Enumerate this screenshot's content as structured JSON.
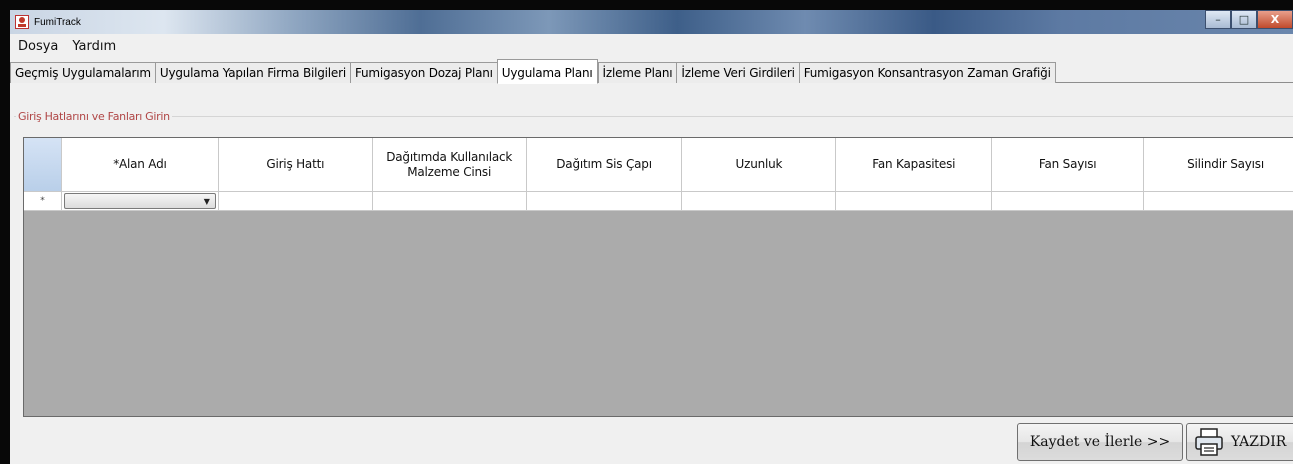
{
  "window": {
    "title": "FumiTrack",
    "controls": {
      "minimize": "–",
      "maximize": "□",
      "close": "X"
    }
  },
  "menu": {
    "items": [
      "Dosya",
      "Yardım"
    ]
  },
  "tabs": [
    "Geçmiş Uygulamalarım",
    "Uygulama Yapılan Firma Bilgileri",
    "Fumigasyon Dozaj Planı",
    "Uygulama Planı",
    "İzleme Planı",
    "İzleme Veri Girdileri",
    "Fumigasyon Konsantrasyon Zaman Grafiği"
  ],
  "active_tab_index": 3,
  "group": {
    "legend": "Giriş Hatlarını ve Fanları Girin"
  },
  "grid": {
    "columns": [
      "*Alan Adı",
      "Giriş Hattı",
      "Dağıtımda Kullanılack Malzeme Cinsi",
      "Dağıtım Sis Çapı",
      "Uzunluk",
      "Fan Kapasitesi",
      "Fan Sayısı",
      "Silindir Sayısı"
    ],
    "new_row_marker": "*",
    "new_row": {
      "alan_adi": "",
      "giris_hatti": "",
      "malzeme": "",
      "sis_capi": "",
      "uzunluk": "",
      "fan_kapasitesi": "",
      "fan_sayisi": "",
      "silindir_sayisi": ""
    }
  },
  "buttons": {
    "save_next": "Kaydet ve İlerle >>",
    "print": "YAZDIR"
  }
}
